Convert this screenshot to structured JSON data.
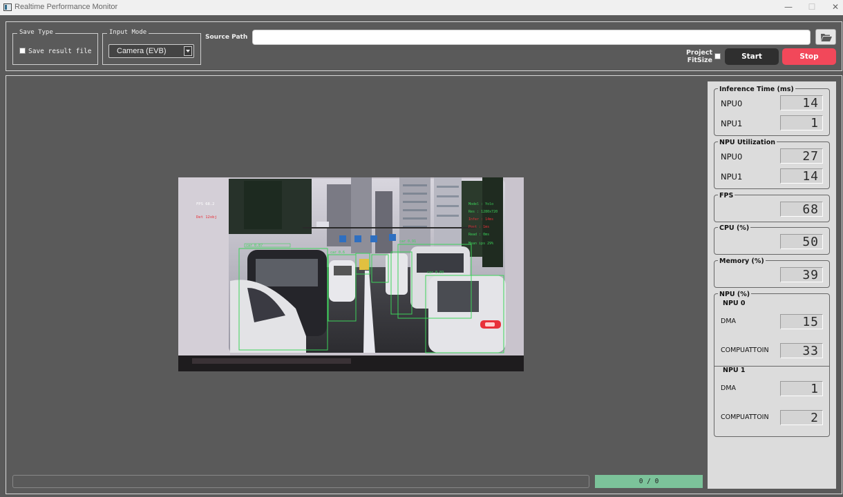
{
  "window": {
    "title": "Realtime Performance Monitor",
    "controls": [
      "—",
      "☐",
      "✕"
    ]
  },
  "top_panel": {
    "save_type": {
      "legend": "Save Type",
      "checkbox_label": "Save result file",
      "checked": false
    },
    "input_mode": {
      "legend": "Input Mode",
      "selected": "Camera (EVB)"
    },
    "source_path": {
      "label": "Source Path",
      "value": ""
    },
    "project_fitsize": {
      "label_line1": "Project",
      "label_line2": "FitSize",
      "checked": false
    },
    "start_label": "Start",
    "stop_label": "Stop"
  },
  "status": {
    "frame_counter": "0 / 0",
    "progress": 0
  },
  "stats": {
    "inference_time": {
      "title": "Inference Time (ms)",
      "rows": [
        {
          "label": "NPU0",
          "value": "14"
        },
        {
          "label": "NPU1",
          "value": "1"
        }
      ]
    },
    "npu_utilization": {
      "title": "NPU Utilization",
      "rows": [
        {
          "label": "NPU0",
          "value": "27"
        },
        {
          "label": "NPU1",
          "value": "14"
        }
      ]
    },
    "fps": {
      "title": "FPS",
      "value": "68"
    },
    "cpu": {
      "title": "CPU (%)",
      "value": "50"
    },
    "memory": {
      "title": "Memory (%)",
      "value": "39"
    },
    "npu_percent": {
      "title": "NPU (%)",
      "npu0": {
        "title": "NPU 0",
        "dma_label": "DMA",
        "dma": "15",
        "comp_label": "COMPUATTOIN",
        "comp": "33"
      },
      "npu1": {
        "title": "NPU 1",
        "dma_label": "DMA",
        "dma": "1",
        "comp_label": "COMPUATTOIN",
        "comp": "2"
      }
    }
  },
  "colors": {
    "background": "#5a5a5a",
    "stop_button": "#f2485a",
    "start_button": "#2f2f2f",
    "frame_counter": "#7cc39a",
    "stats_panel": "#dcdcdc",
    "detection_box": "#3cd35a"
  }
}
